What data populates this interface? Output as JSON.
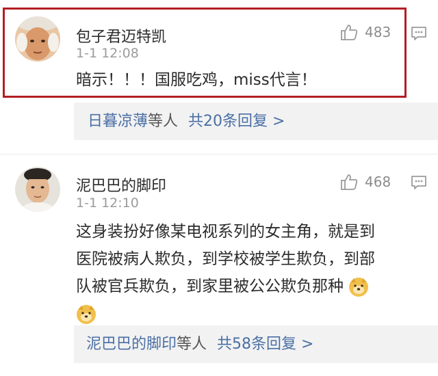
{
  "comments": [
    {
      "username": "包子君迈特凯",
      "time": "1-1 12:08",
      "likes": "483",
      "text": "暗示！！！国服吃鸡，miss代言！",
      "replies": {
        "names": "日暮凉薄",
        "etal": "等人",
        "count": "共20条回复 >"
      },
      "highlighted": true
    },
    {
      "username": "泥巴巴的脚印",
      "time": "1-1 12:10",
      "likes": "468",
      "text_lines": [
        "这身装扮好像某电视系列的女主角，就是到",
        "医院被病人欺负，到学校被学生欺负，到部",
        "队被官兵欺负，到家里被公公欺负那种"
      ],
      "emoji": "doge-emoji",
      "replies": {
        "names": "泥巴巴的脚印",
        "etal": "等人",
        "count": "共58条回复 >"
      }
    }
  ],
  "colors": {
    "highlight": "#b31d23",
    "link": "#4a6fa5",
    "reply_bg": "#f2f2f2"
  },
  "icons": [
    "thumbs-up-icon",
    "comment-icon",
    "doge-emoji"
  ]
}
